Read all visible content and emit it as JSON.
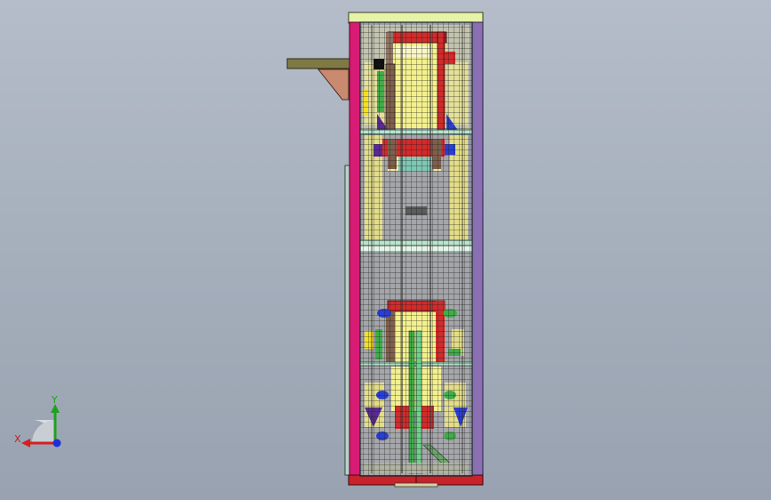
{
  "view": {
    "name": "cad-viewport",
    "colors": {
      "background_top": "#b4bdc9",
      "background_bottom": "#98a2b0",
      "frame_left": "#d81b74",
      "frame_right": "#8a6fb3",
      "top_cap": "#e6f2a6",
      "base_plate": "#c8222a",
      "mesh": "#1a1a1a",
      "panel_fill": "#9c9fa8",
      "yellow_fill": "#f3f08f",
      "red_part": "#d22b2b",
      "green_part": "#3fae4a",
      "purple_part": "#5a2b92",
      "blue_part": "#2a3fd0",
      "arm": "#7f7a45",
      "bracket": "#c98a6f"
    }
  },
  "triad": {
    "x_label": "X",
    "y_label": "Y",
    "x_color": "#d61f1f",
    "y_color": "#1ea21e",
    "z_color": "#1f2fd8"
  }
}
